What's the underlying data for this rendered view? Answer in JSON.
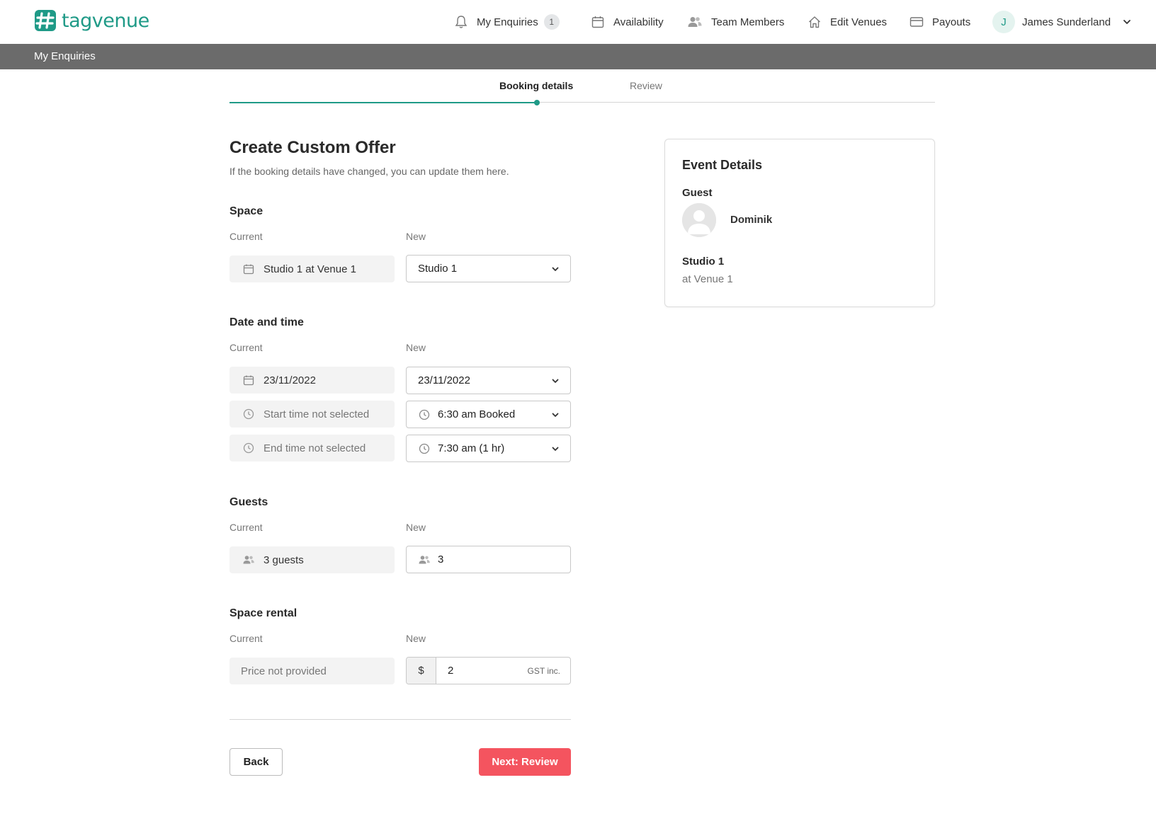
{
  "brand": {
    "name": "tagvenue",
    "color": "#1f9a87"
  },
  "nav": {
    "enquiries": {
      "label": "My Enquiries",
      "count": "1"
    },
    "availability": "Availability",
    "team": "Team Members",
    "edit_venues": "Edit Venues",
    "payouts": "Payouts",
    "user": {
      "initial": "J",
      "name": "James Sunderland"
    }
  },
  "subbar": {
    "title": "My Enquiries"
  },
  "steps": {
    "active": "Booking details",
    "next": "Review"
  },
  "form": {
    "title": "Create Custom Offer",
    "subtitle": "If the booking details have changed, you can update them here.",
    "current_label": "Current",
    "new_label": "New",
    "space": {
      "title": "Space",
      "current": "Studio 1 at Venue 1",
      "new": "Studio 1"
    },
    "datetime": {
      "title": "Date and time",
      "current_date": "23/11/2022",
      "new_date": "23/11/2022",
      "current_start": "Start time not selected",
      "new_start": "6:30 am Booked",
      "current_end": "End time not selected",
      "new_end": "7:30 am (1 hr)"
    },
    "guests": {
      "title": "Guests",
      "current": "3 guests",
      "new": "3"
    },
    "rental": {
      "title": "Space rental",
      "current": "Price not provided",
      "currency": "$",
      "new": "2",
      "suffix": "GST inc."
    },
    "back": "Back",
    "next": "Next: Review",
    "accent": "#f4545f"
  },
  "event": {
    "title": "Event Details",
    "guest_label": "Guest",
    "guest_name": "Dominik",
    "space": "Studio 1",
    "venue": "at Venue 1"
  }
}
